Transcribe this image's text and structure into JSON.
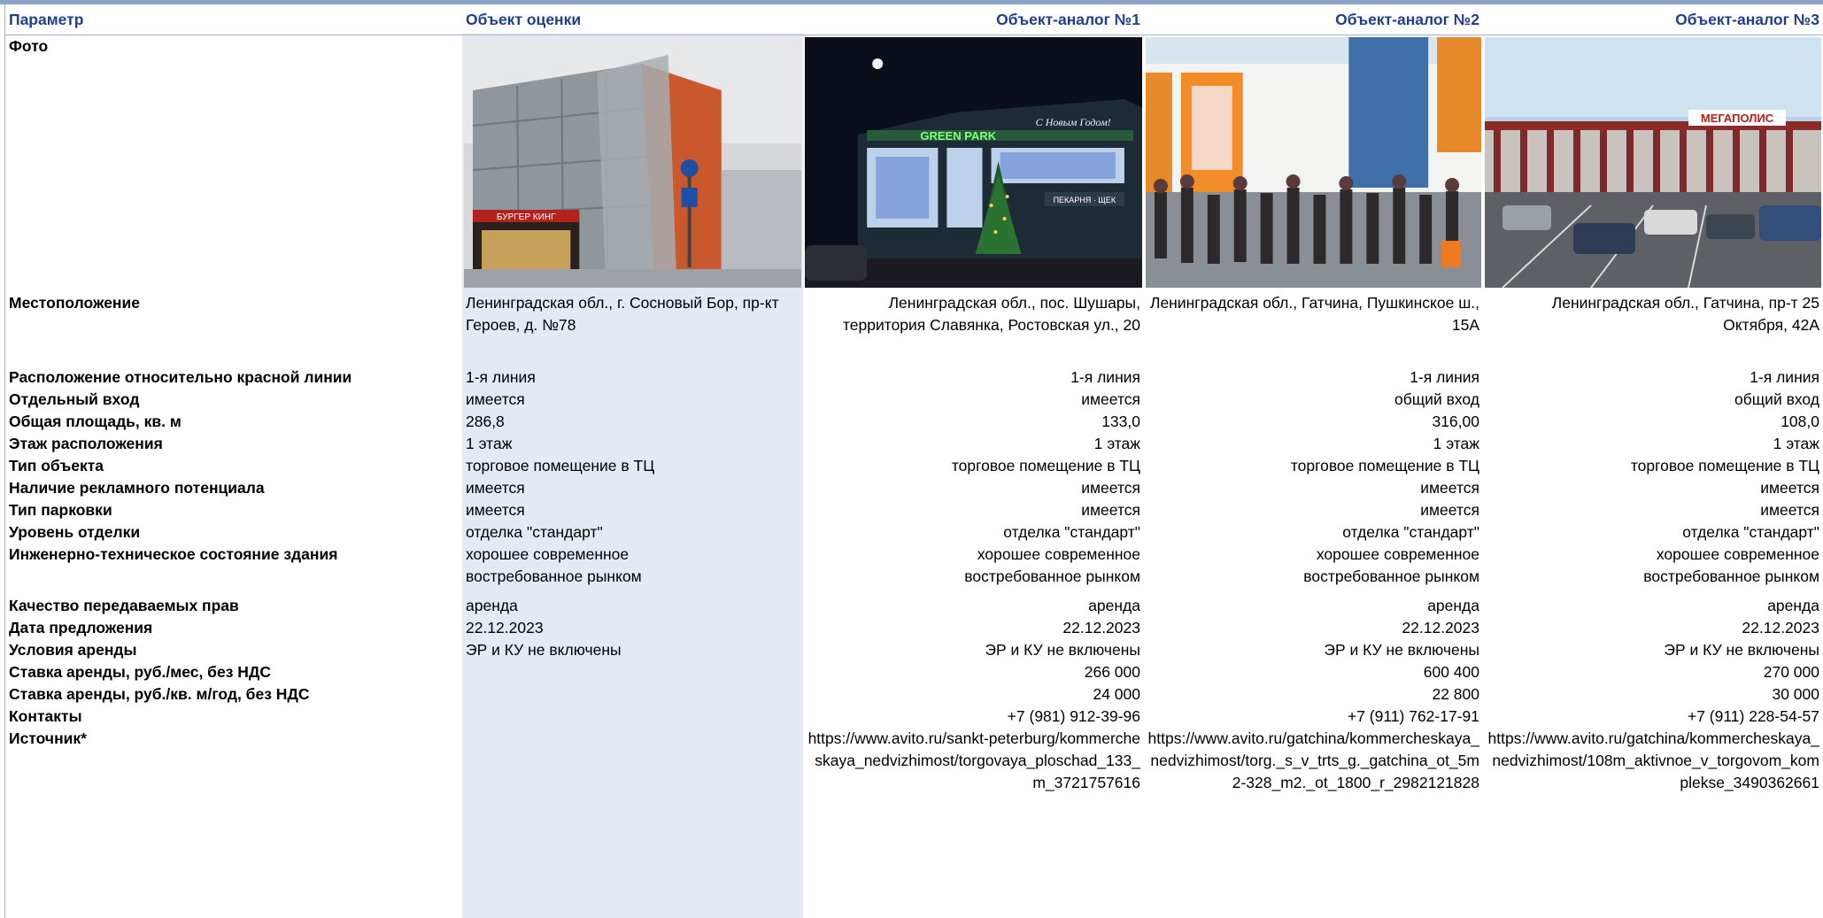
{
  "headers": [
    "Параметр",
    "Объект оценки",
    "Объект-аналог №1",
    "Объект-аналог №2",
    "Объект-аналог №3"
  ],
  "photo_label": "Фото",
  "photos": [
    {
      "name": "photo-object-icon",
      "sign": "БУРГЕР КИНГ"
    },
    {
      "name": "photo-analog1-icon",
      "sign": "GREEN PARK",
      "sign2": "С Новым Годом!",
      "sign3": "ПЕКАРНЯ · ЩЕК"
    },
    {
      "name": "photo-analog2-icon"
    },
    {
      "name": "photo-analog3-icon",
      "sign": "МЕГАПОЛИС"
    }
  ],
  "rows": [
    {
      "label": "Местоположение",
      "values": [
        "Ленинградская обл., г. Сосновый Бор, пр-кт Героев, д. №78",
        "Ленинградская обл., пос. Шушары, территория Славянка, Ростовская ул., 20",
        "Ленинградская обл., Гатчина, Пушкинское ш., 15А",
        "Ленинградская обл., Гатчина, пр-т 25 Октября, 42А"
      ]
    },
    {
      "label": "Расположение относительно красной линии",
      "values": [
        "1-я линия",
        "1-я линия",
        "1-я линия",
        "1-я линия"
      ]
    },
    {
      "label": "Отдельный вход",
      "values": [
        "имеется",
        "имеется",
        "общий вход",
        "общий вход"
      ]
    },
    {
      "label": "Общая площадь, кв. м",
      "values": [
        "286,8",
        "133,0",
        "316,00",
        "108,0"
      ]
    },
    {
      "label": "Этаж расположения",
      "values": [
        "1 этаж",
        "1 этаж",
        "1 этаж",
        "1 этаж"
      ]
    },
    {
      "label": "Тип объекта",
      "values": [
        "торговое помещение в ТЦ",
        "торговое помещение в ТЦ",
        "торговое помещение в ТЦ",
        "торговое помещение в ТЦ"
      ]
    },
    {
      "label": "Наличие рекламного потенциала",
      "values": [
        "имеется",
        "имеется",
        "имеется",
        "имеется"
      ]
    },
    {
      "label": "Тип парковки",
      "values": [
        "имеется",
        "имеется",
        "имеется",
        "имеется"
      ]
    },
    {
      "label": "Уровень отделки",
      "values": [
        "отделка \"стандарт\"",
        "отделка \"стандарт\"",
        "отделка \"стандарт\"",
        "отделка \"стандарт\""
      ]
    },
    {
      "label": "Инженерно-техническое состояние здания",
      "values": [
        "хорошее современное востребованное рынком",
        "хорошее современное востребованное рынком",
        "хорошее современное востребованное рынком",
        "хорошее современное востребованное рынком"
      ]
    },
    {
      "label": "Качество передаваемых прав",
      "values": [
        "аренда",
        "аренда",
        "аренда",
        "аренда"
      ]
    },
    {
      "label": "Дата предложения",
      "values": [
        "22.12.2023",
        "22.12.2023",
        "22.12.2023",
        "22.12.2023"
      ]
    },
    {
      "label": "Условия аренды",
      "values": [
        "ЭР и КУ не включены",
        "ЭР и КУ не включены",
        "ЭР и КУ не включены",
        "ЭР и КУ не включены"
      ]
    },
    {
      "label": "Ставка аренды, руб./мес, без НДС",
      "values": [
        "",
        "266 000",
        "600 400",
        "270 000"
      ]
    },
    {
      "label": "Ставка аренды, руб./кв. м/год, без НДС",
      "values": [
        "",
        "24 000",
        "22 800",
        "30 000"
      ]
    },
    {
      "label": "Контакты",
      "values": [
        "",
        "+7 (981) 912-39-96",
        "+7 (911) 762-17-91",
        "+7 (911) 228-54-57"
      ]
    },
    {
      "label": "Источник*",
      "values": [
        "",
        "https://www.avito.ru/sankt-peterburg/kommercheskaya_nedvizhimost/torgovaya_ploschad_133_m_3721757616",
        "https://www.avito.ru/gatchina/kommercheskaya_nedvizhimost/torg._s_v_trts_g._gatchina_ot_5m2-328_m2._ot_1800_r_2982121828",
        "https://www.avito.ru/gatchina/kommercheskaya_nedvizhimost/108m_aktivnoe_v_torgovom_komplekse_3490362661"
      ]
    }
  ]
}
